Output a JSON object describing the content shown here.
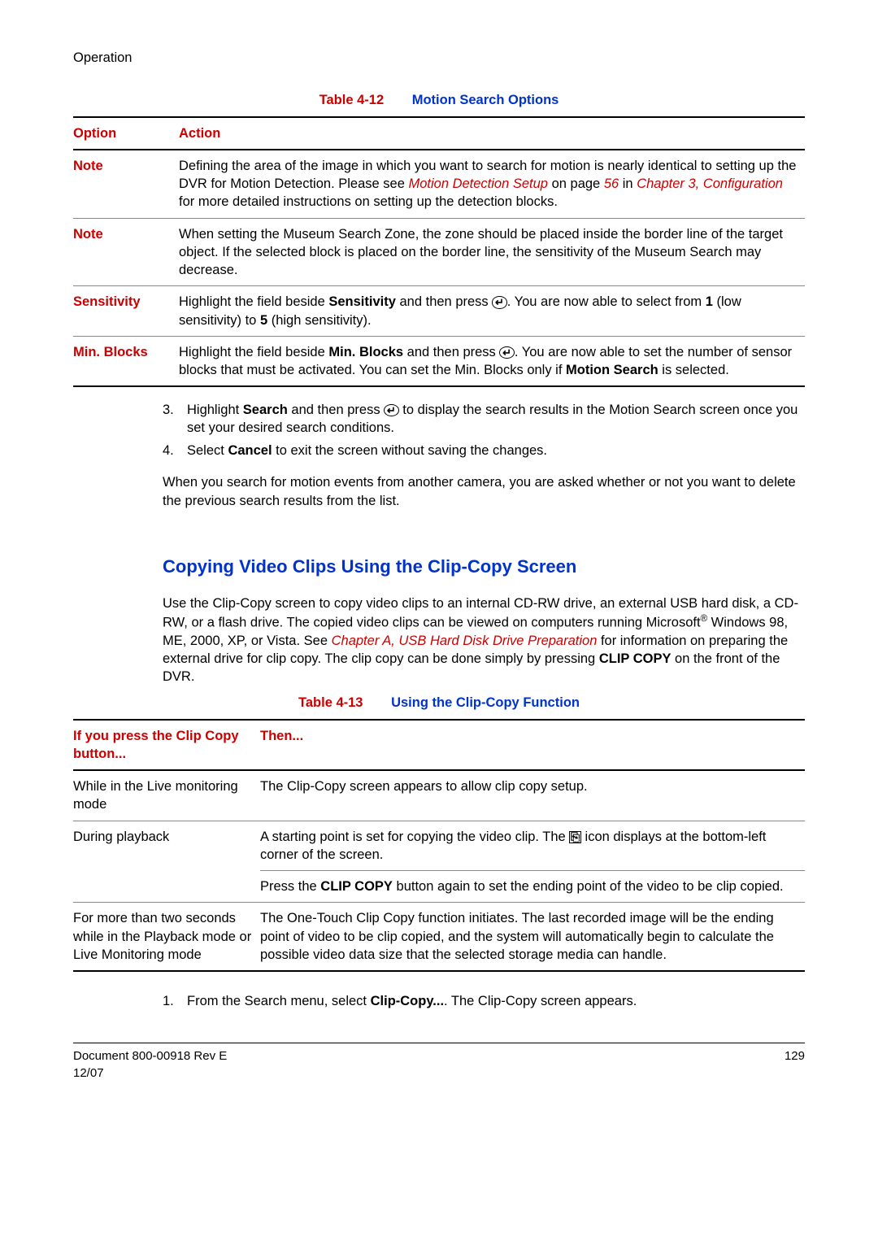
{
  "header": {
    "section": "Operation"
  },
  "table12": {
    "caption_num": "Table 4-12",
    "caption_title": "Motion Search Options",
    "col1": "Option",
    "col2": "Action",
    "rows": {
      "note1": {
        "label": "Note",
        "t1": "Defining the area of the image in which you want to search for motion is nearly identical to setting up the DVR for Motion Detection. Please see ",
        "link1": "Motion Detection Setup",
        "t2": " on page ",
        "page": "56",
        "t3": " in ",
        "link2": "Chapter 3, Configuration",
        "t4": " for more detailed instructions on setting up the detection blocks."
      },
      "note2": {
        "label": "Note",
        "text": "When setting the Museum Search Zone, the zone should be placed inside the border line of the target object. If the selected block is placed on the border line, the sensitivity of the Museum Search may decrease."
      },
      "sens": {
        "label": "Sensitivity",
        "t1": "Highlight the field beside ",
        "b1": "Sensitivity",
        "t2": " and then press ",
        "t3": ". You are now able to select from ",
        "b2": "1",
        "t4": " (low sensitivity) to ",
        "b3": "5",
        "t5": " (high sensitivity)."
      },
      "min": {
        "label": "Min. Blocks",
        "t1": "Highlight the field beside ",
        "b1": "Min. Blocks",
        "t2": " and then press ",
        "t3": ". You are now able to set the number of sensor blocks that must be activated. You can set the Min. Blocks only if ",
        "b2": "Motion Search",
        "t4": " is selected."
      }
    }
  },
  "steps_a": {
    "s3_num": "3.",
    "s3_t1": "Highlight ",
    "s3_b1": "Search",
    "s3_t2": " and then press ",
    "s3_t3": " to display the search results in the Motion Search screen once you set your desired search conditions.",
    "s4_num": "4.",
    "s4_t1": "Select ",
    "s4_b1": "Cancel",
    "s4_t2": " to exit the screen without saving the changes.",
    "after": "When you search for motion events from another camera, you are asked whether or not you want to delete the previous search results from the list."
  },
  "heading2": "Copying Video Clips Using the Clip-Copy Screen",
  "clipcopy_intro": {
    "t1": "Use the Clip-Copy screen to copy video clips to an internal CD-RW drive, an external USB hard disk, a CD-RW, or a flash drive. The copied video clips can be viewed on computers running Microsoft",
    "reg": "®",
    "t2": " Windows 98, ME, 2000, XP, or Vista. See ",
    "link": "Chapter A, USB Hard Disk Drive Preparation",
    "t3": " for information on preparing the external drive for clip copy. The clip copy can be done simply by pressing ",
    "b1": "CLIP COPY",
    "t4": " on the front of the DVR."
  },
  "table13": {
    "caption_num": "Table 4-13",
    "caption_title": "Using the Clip-Copy Function",
    "col1": "If you press the Clip Copy button...",
    "col2": "Then...",
    "rows": {
      "r1": {
        "c1": "While in the Live monitoring mode",
        "c2": "The Clip-Copy screen appears to allow clip copy setup."
      },
      "r2": {
        "c1": "During playback",
        "c2a_t1": "A starting point is set for copying the video clip. The ",
        "c2a_t2": " icon displays at the bottom-left corner of the screen.",
        "c2b_t1": "Press the ",
        "c2b_b1": "CLIP COPY",
        "c2b_t2": " button again to set the ending point of the video to be clip copied."
      },
      "r3": {
        "c1": "For more than two seconds while in the Playback mode or Live Monitoring mode",
        "c2": "The One-Touch Clip Copy function initiates. The last recorded image will be the ending point of video to be clip copied, and the system will automatically begin to calculate the possible video data size that the selected storage media can handle."
      }
    }
  },
  "steps_b": {
    "s1_num": "1.",
    "s1_t1": "From the Search menu, select ",
    "s1_b1": "Clip-Copy...",
    "s1_t2": ". The Clip-Copy screen appears."
  },
  "footer": {
    "doc": "Document 800-00918 Rev E",
    "date": "12/07",
    "page": "129"
  },
  "icons": {
    "enter_glyph": "↵",
    "copy_glyph": "⎘"
  }
}
